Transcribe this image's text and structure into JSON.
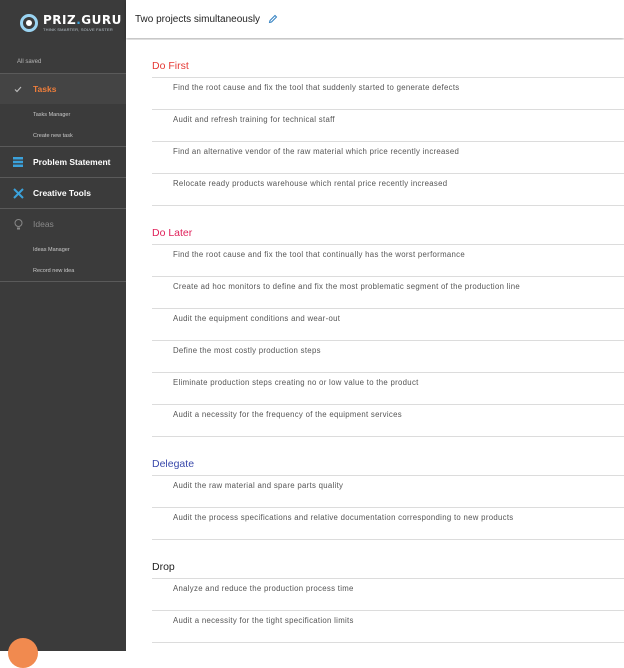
{
  "sidebar": {
    "logo": {
      "name": "PRIZ",
      "dot": ".",
      "suffix": "GURU",
      "tagline": "THINK SMARTER, SOLVE FASTER"
    },
    "status": "All saved",
    "items": [
      {
        "label": "Tasks",
        "icon": "check-icon",
        "active": true,
        "sub": [
          "Tasks Manager",
          "Create new task"
        ]
      },
      {
        "label": "Problem Statement",
        "icon": "layers-icon"
      },
      {
        "label": "Creative Tools",
        "icon": "tools-icon"
      },
      {
        "label": "Ideas",
        "icon": "lightbulb-icon",
        "disabled": true,
        "sub": [
          "Ideas Manager",
          "Record new idea"
        ]
      }
    ]
  },
  "header": {
    "title": "Two projects simultaneously",
    "edit_icon": "pencil-icon"
  },
  "colors": {
    "do_first": "#e53935",
    "do_later": "#e0215a",
    "delegate": "#3949ab",
    "drop": "#212121",
    "accent": "#ef7e3b",
    "sidebar": "#3b3b3b"
  },
  "sections": [
    {
      "title": "Do First",
      "tasks": [
        "Find the root cause and fix the tool that suddenly started to generate defects",
        "Audit and refresh training for technical staff",
        "Find an alternative vendor of the raw material which price recently increased",
        "Relocate ready products warehouse which rental price recently increased"
      ]
    },
    {
      "title": "Do Later",
      "tasks": [
        "Find the root cause and fix the tool that continually has the worst performance",
        "Create ad hoc monitors to define and fix the most problematic segment of the production line",
        "Audit the equipment conditions and wear-out",
        "Define the most costly production steps",
        "Eliminate production steps creating no or low value to the product",
        "Audit a necessity for the frequency of the equipment services"
      ]
    },
    {
      "title": "Delegate",
      "tasks": [
        "Audit the raw material and spare parts quality",
        "Audit the process specifications and relative documentation corresponding to new products"
      ]
    },
    {
      "title": "Drop",
      "tasks": [
        "Analyze and reduce the production process time",
        "Audit a necessity for the tight specification limits"
      ]
    }
  ]
}
